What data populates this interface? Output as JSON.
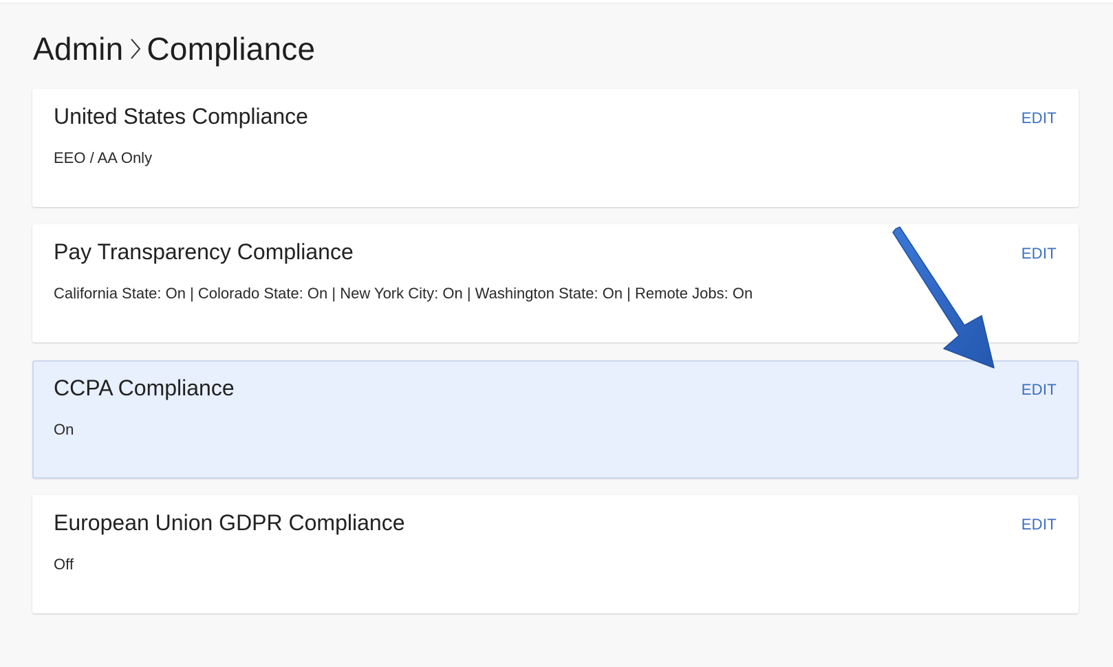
{
  "breadcrumb": {
    "parent": "Admin",
    "current": "Compliance",
    "separator_icon": "chevron-right-icon"
  },
  "sections": [
    {
      "title": "United States Compliance",
      "value": "EEO / AA Only",
      "edit_label": "EDIT"
    },
    {
      "title": "Pay Transparency Compliance",
      "value": "California State: On | Colorado State: On | New York City: On | Washington State: On | Remote Jobs: On",
      "edit_label": "EDIT"
    },
    {
      "title": "CCPA Compliance",
      "value": "On",
      "edit_label": "EDIT",
      "highlighted": true
    },
    {
      "title": "European Union GDPR Compliance",
      "value": "Off",
      "edit_label": "EDIT"
    }
  ],
  "annotation": {
    "icon": "arrow-pointer-icon",
    "color": "#2b66c4"
  },
  "colors": {
    "link": "#3a6ec2",
    "highlight_bg": "#e9f0fd",
    "highlight_border": "#c9d8ef"
  }
}
